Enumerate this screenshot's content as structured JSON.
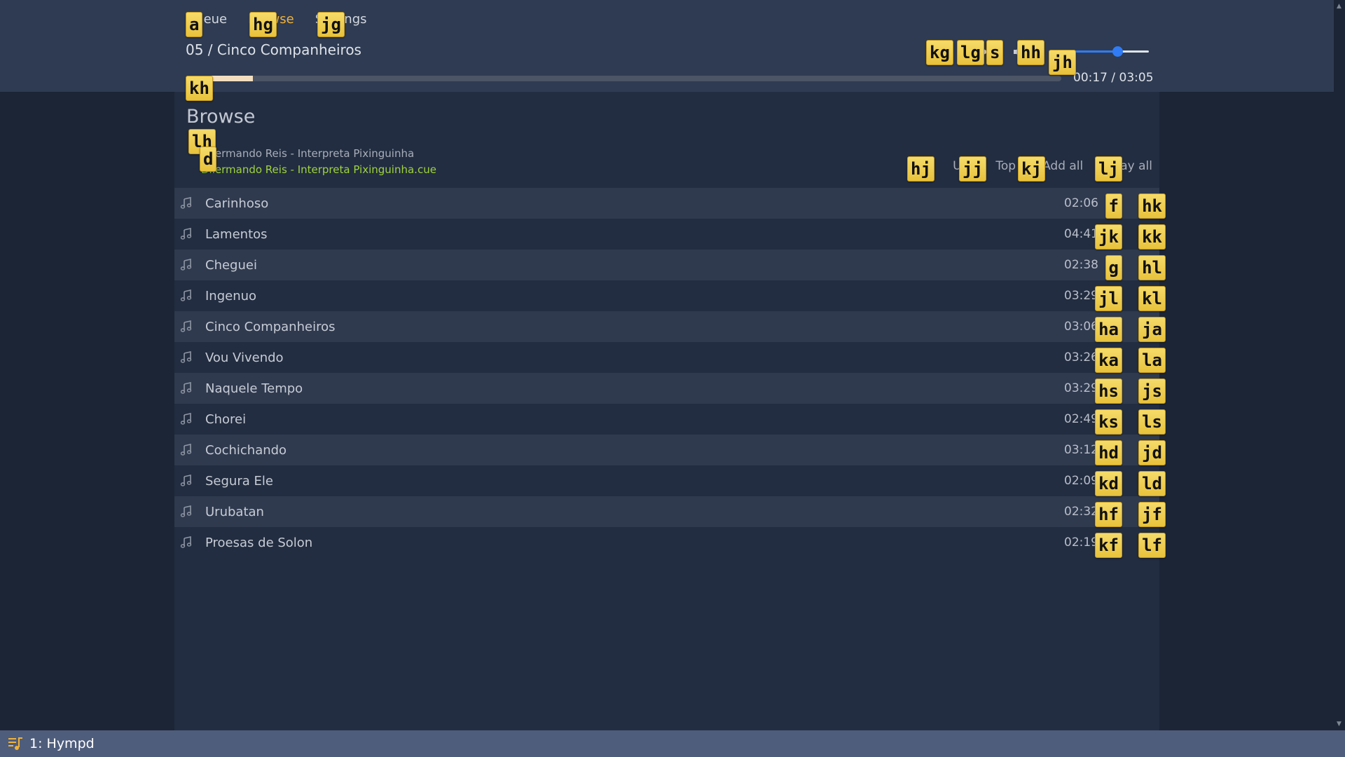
{
  "nav": {
    "items": [
      {
        "label": "Queue",
        "hint": "a"
      },
      {
        "label": "Browse",
        "hint": "hg"
      },
      {
        "label": "Settings",
        "hint": "jg"
      }
    ]
  },
  "now_playing": {
    "title": "05 / Cinco Companheiros",
    "time": "00:17 / 03:05",
    "progress_fraction": 0.077,
    "volume_fraction": 0.68,
    "progress_hint": "kh"
  },
  "controls": {
    "prev_icon": "prev-icon",
    "play_pause_icon": "pause-icon",
    "next_icon": "next-icon",
    "stop_icon": "stop-icon",
    "hints": {
      "prev": "kg",
      "play": "lg",
      "next": "s",
      "mute": "hh",
      "volume": "jh"
    }
  },
  "browse": {
    "title": "Browse",
    "crumb_root": "/",
    "crumb_folder": "Dilermando Reis - Interpreta Pixinguinha",
    "crumb_file": "Dilermando Reis - Interpreta Pixinguinha.cue",
    "crumb_hints": {
      "root": "lh",
      "folder": "d"
    },
    "actions": [
      {
        "label": "Up",
        "hint": "hj"
      },
      {
        "label": "Top",
        "hint": "jj"
      },
      {
        "label": "Add all",
        "hint": "kj"
      },
      {
        "label": "Play all",
        "hint": "lj"
      }
    ]
  },
  "tracks": [
    {
      "title": "Carinhoso",
      "duration": "02:06",
      "hint_add": "f",
      "hint_play": "hk"
    },
    {
      "title": "Lamentos",
      "duration": "04:41",
      "hint_add": "jk",
      "hint_play": "kk"
    },
    {
      "title": "Cheguei",
      "duration": "02:38",
      "hint_add": "g",
      "hint_play": "hl"
    },
    {
      "title": "Ingenuo",
      "duration": "03:29",
      "hint_add": "jl",
      "hint_play": "kl"
    },
    {
      "title": "Cinco Companheiros",
      "duration": "03:06",
      "hint_add": "ha",
      "hint_play": "ja"
    },
    {
      "title": "Vou Vivendo",
      "duration": "03:26",
      "hint_add": "ka",
      "hint_play": "la"
    },
    {
      "title": "Naquele Tempo",
      "duration": "03:29",
      "hint_add": "hs",
      "hint_play": "js"
    },
    {
      "title": "Chorei",
      "duration": "02:49",
      "hint_add": "ks",
      "hint_play": "ls"
    },
    {
      "title": "Cochichando",
      "duration": "03:12",
      "hint_add": "hd",
      "hint_play": "jd"
    },
    {
      "title": "Segura Ele",
      "duration": "02:09",
      "hint_add": "kd",
      "hint_play": "ld"
    },
    {
      "title": "Urubatan",
      "duration": "02:32",
      "hint_add": "hf",
      "hint_play": "jf"
    },
    {
      "title": "Proesas de Solon",
      "duration": "02:19",
      "hint_add": "kf",
      "hint_play": "lf"
    }
  ],
  "taskbar": {
    "label": "1: Hympd",
    "icon": "music-playlist-icon"
  },
  "colors": {
    "accent": "#f0b23a",
    "current_file": "#9fd33c",
    "volume": "#2f7cf6",
    "header_bg": "#2e3b52",
    "panel_bg": "#222d41",
    "row_alt_bg": "#2f3a4f",
    "taskbar_bg": "#4f5d7c"
  }
}
